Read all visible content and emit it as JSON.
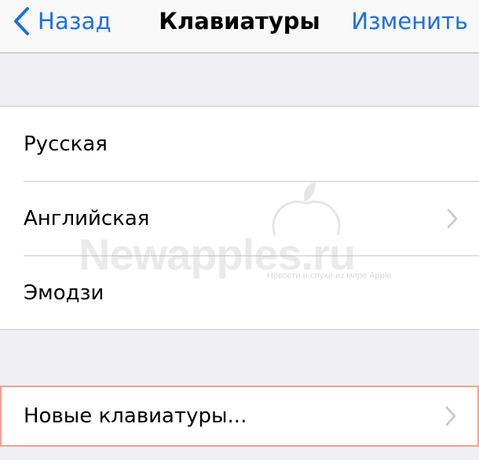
{
  "navbar": {
    "back_label": "Назад",
    "title": "Клавиатуры",
    "edit_label": "Изменить",
    "tint_color": "#1d6fe0"
  },
  "keyboards": {
    "items": [
      {
        "label": "Русская",
        "chevron": false
      },
      {
        "label": "Английская",
        "chevron": true
      },
      {
        "label": "Эмодзи",
        "chevron": false
      }
    ]
  },
  "add_section": {
    "label": "Новые клавиатуры...",
    "chevron": true,
    "highlight_color": "#f0a090"
  },
  "watermark": {
    "brand": "Newapples.ru",
    "tagline": "Новости и слухи из мире Apple"
  }
}
